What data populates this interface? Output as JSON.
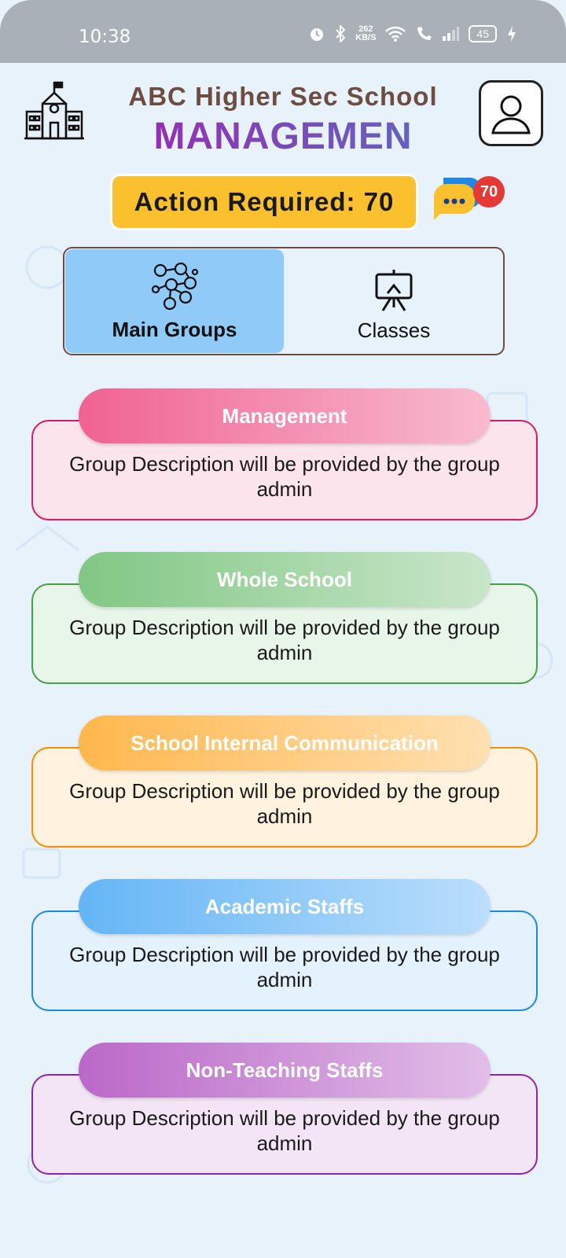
{
  "status_bar": {
    "time": "10:38",
    "net_speed_value": "262",
    "net_speed_unit": "KB/S",
    "battery": "45",
    "icons": [
      "alarm-icon",
      "bluetooth-icon",
      "wifi-icon",
      "wifi-call-icon",
      "signal-icon",
      "charging-icon"
    ]
  },
  "header": {
    "school_name": "ABC Higher Sec School",
    "role": "MANAGEMEN",
    "school_icon": "school-building-icon",
    "profile_icon": "user-profile-icon"
  },
  "action": {
    "label": "Action Required: 70",
    "chat_badge": "70",
    "chat_icon": "chat-bubbles-icon"
  },
  "tabs": [
    {
      "label": "Main Groups",
      "icon": "group-network-icon",
      "active": true
    },
    {
      "label": "Classes",
      "icon": "presentation-board-icon",
      "active": false
    }
  ],
  "groups": [
    {
      "title": "Management",
      "description": "Group Description will be provided by the group admin",
      "header_from": "#f06292",
      "header_to": "#f8bbd0",
      "border": "#d81b60",
      "body_bg": "#fce4ec"
    },
    {
      "title": "Whole School",
      "description": "Group Description will be provided by the group admin",
      "header_from": "#81c784",
      "header_to": "#c8e6c9",
      "border": "#43a047",
      "body_bg": "#e8f5e9"
    },
    {
      "title": "School Internal Communication",
      "description": "Group Description will be provided by the group admin",
      "header_from": "#ffb74d",
      "header_to": "#ffe0b2",
      "border": "#fb8c00",
      "body_bg": "#fff3e0"
    },
    {
      "title": "Academic Staffs",
      "description": "Group Description will be provided by the group admin",
      "header_from": "#64b5f6",
      "header_to": "#bbdefb",
      "border": "#1e88e5",
      "body_bg": "#e3f2fd"
    },
    {
      "title": "Non-Teaching Staffs",
      "description": "Group Description will be provided by the group admin",
      "header_from": "#ba68c8",
      "header_to": "#e1bee7",
      "border": "#8e24aa",
      "body_bg": "#f3e5f5"
    }
  ]
}
